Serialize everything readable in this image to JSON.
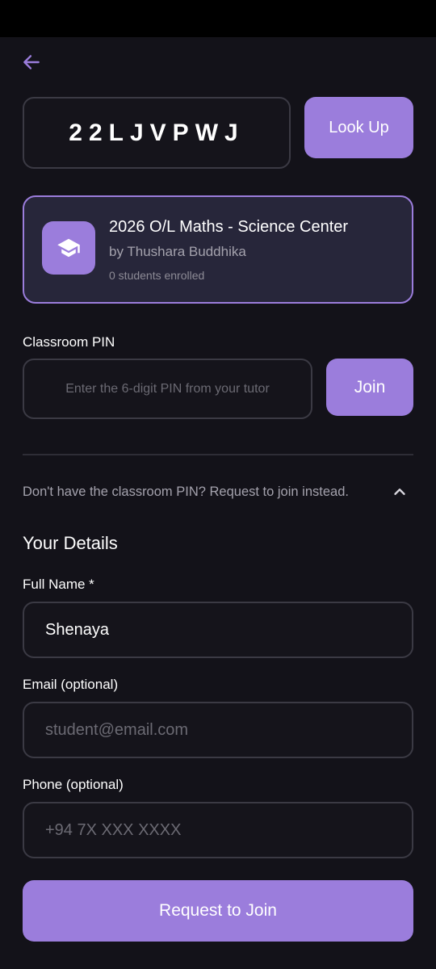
{
  "lookup": {
    "class_code": "22LJVPWJ",
    "button_label": "Look Up"
  },
  "classroom": {
    "title": "2026 O/L Maths - Science Center",
    "tutor": "by Thushara Buddhika",
    "enrolled": "0 students enrolled",
    "icon": "graduation-cap-icon"
  },
  "pin": {
    "label": "Classroom PIN",
    "placeholder": "Enter the 6-digit PIN from your tutor",
    "join_label": "Join"
  },
  "request": {
    "toggle_text": "Don't have the classroom PIN? Request to join instead.",
    "toggle_icon": "chevron-up-icon"
  },
  "details": {
    "section_title": "Your Details",
    "full_name_label": "Full Name *",
    "full_name_value": "Shenaya",
    "email_label": "Email (optional)",
    "email_placeholder": "student@email.com",
    "phone_label": "Phone (optional)",
    "phone_placeholder": "+94 7X XXX XXXX",
    "submit_label": "Request to Join"
  },
  "colors": {
    "accent": "#9b7ddc",
    "background": "#131219",
    "card": "#27263a",
    "border": "#3b3a44"
  }
}
